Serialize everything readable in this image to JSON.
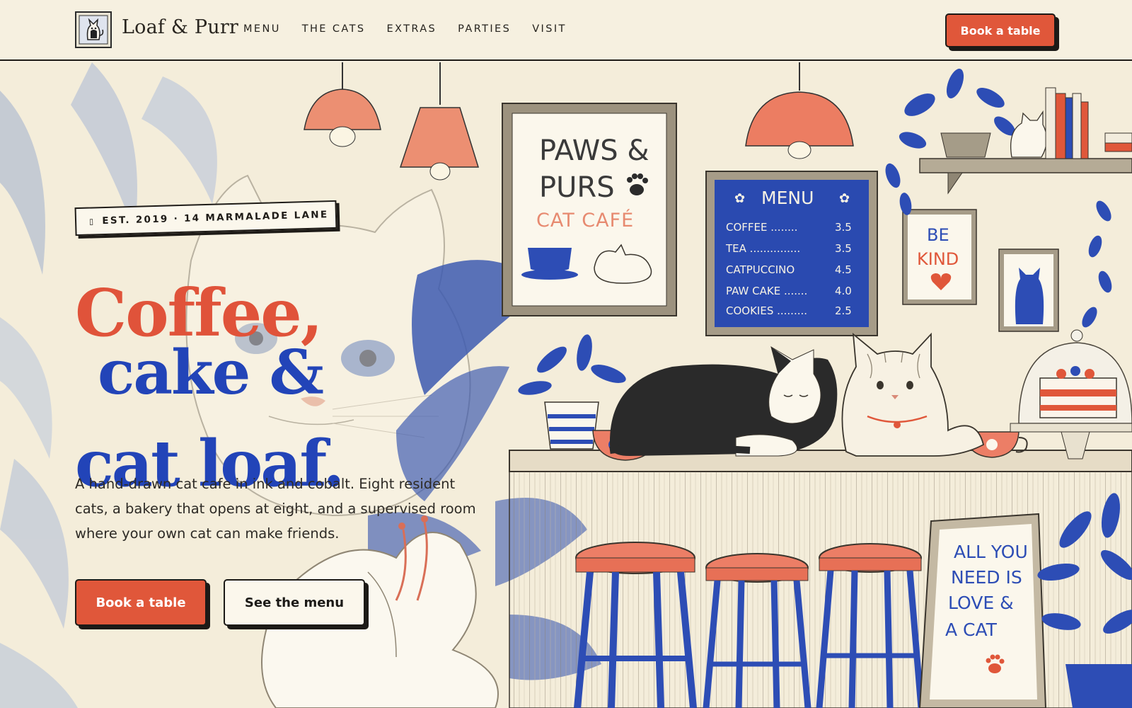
{
  "header": {
    "brand": "Loaf & Purr",
    "nav": [
      "MENU",
      "THE CATS",
      "EXTRAS",
      "PARTIES",
      "VISIT"
    ],
    "cta": "Book a table"
  },
  "hero": {
    "badge_icon": "▯",
    "badge": "EST. 2019 · 14 MARMALADE LANE",
    "headline": [
      "Coffee,",
      "cake &",
      "cat loaf."
    ],
    "lede": "A hand-drawn cat cafe in ink and cobalt. Eight resident cats, a bakery that opens at eight, and a supervised room where your own cat can make friends.",
    "primary_cta": "Book a table",
    "secondary_cta": "See the menu"
  },
  "illustration": {
    "sign": [
      "PAWS &",
      "PURS",
      "CAT CAFÉ"
    ],
    "menu_title": "MENU",
    "menu_items": [
      {
        "name": "COFFEE ........",
        "price": "3.5"
      },
      {
        "name": "TEA ...............",
        "price": "3.5"
      },
      {
        "name": "CATPUCCINO",
        "price": "4.5"
      },
      {
        "name": "PAW CAKE .......",
        "price": "4.0"
      },
      {
        "name": "COOKIES .........",
        "price": "2.5"
      }
    ],
    "be_kind": [
      "BE",
      "KIND"
    ],
    "easel": [
      "ALL YOU",
      "NEED IS",
      "LOVE &",
      "A CAT"
    ]
  },
  "colors": {
    "accent_red": "#e0573a",
    "cobalt": "#2244b8",
    "cream": "#f4edda",
    "ink": "#1c1a17"
  }
}
